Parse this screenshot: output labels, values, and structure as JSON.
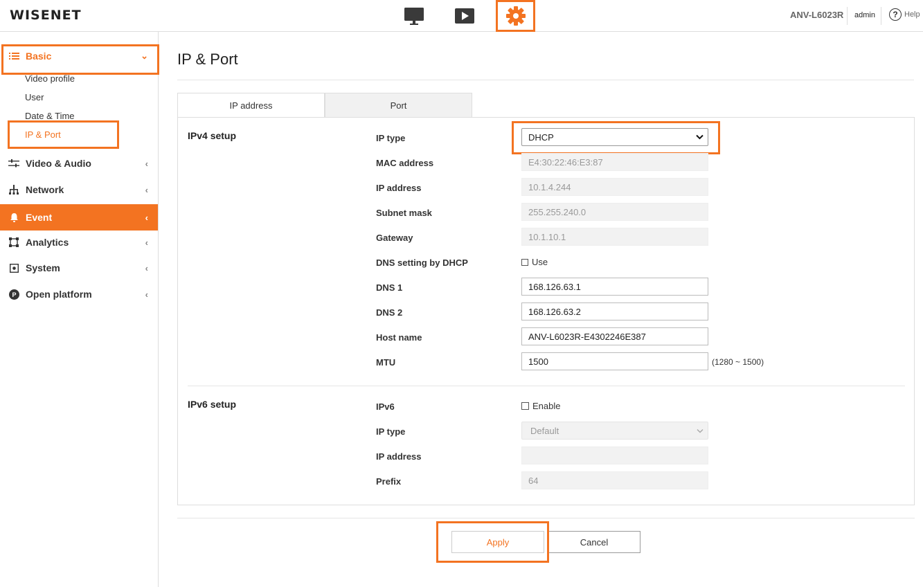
{
  "header": {
    "logo": "WISENET",
    "model": "ANV-L6023R",
    "user": "admin",
    "help_label": "Help",
    "help_glyph": "?",
    "icons": [
      "monitor-icon",
      "play-icon",
      "gear-icon"
    ]
  },
  "sidebar": {
    "basic": {
      "label": "Basic",
      "chevron": "⌄"
    },
    "basic_sub": [
      "Video profile",
      "User",
      "Date & Time",
      "IP & Port"
    ],
    "items": [
      {
        "label": "Video & Audio",
        "icon": "sliders-icon",
        "chevron": "‹"
      },
      {
        "label": "Network",
        "icon": "network-icon",
        "chevron": "‹"
      },
      {
        "label": "Event",
        "icon": "bell-icon",
        "chevron": "‹"
      },
      {
        "label": "Analytics",
        "icon": "analytics-icon",
        "chevron": "‹"
      },
      {
        "label": "System",
        "icon": "system-icon",
        "chevron": "‹"
      },
      {
        "label": "Open platform",
        "icon": "open-platform-icon",
        "chevron": "‹"
      }
    ]
  },
  "page": {
    "title": "IP & Port",
    "tabs": [
      "IP address",
      "Port"
    ]
  },
  "ipv4": {
    "title": "IPv4 setup",
    "ip_type_label": "IP type",
    "ip_type_value": "DHCP",
    "mac_label": "MAC address",
    "mac_value": "E4:30:22:46:E3:87",
    "ip_label": "IP address",
    "ip_value": "10.1.4.244",
    "subnet_label": "Subnet mask",
    "subnet_value": "255.255.240.0",
    "gateway_label": "Gateway",
    "gateway_value": "10.1.10.1",
    "dns_dhcp_label": "DNS setting by DHCP",
    "dns_dhcp_check": "Use",
    "dns1_label": "DNS 1",
    "dns1_value": "168.126.63.1",
    "dns2_label": "DNS 2",
    "dns2_value": "168.126.63.2",
    "host_label": "Host name",
    "host_value": "ANV-L6023R-E4302246E387",
    "mtu_label": "MTU",
    "mtu_value": "1500",
    "mtu_hint": "(1280 ~ 1500)"
  },
  "ipv6": {
    "title": "IPv6 setup",
    "ipv6_label": "IPv6",
    "enable_label": "Enable",
    "ip_type_label": "IP type",
    "ip_type_value": "Default",
    "ip_label": "IP address",
    "ip_value": "",
    "prefix_label": "Prefix",
    "prefix_value": "64"
  },
  "buttons": {
    "apply": "Apply",
    "cancel": "Cancel"
  },
  "colors": {
    "accent": "#f37321"
  }
}
